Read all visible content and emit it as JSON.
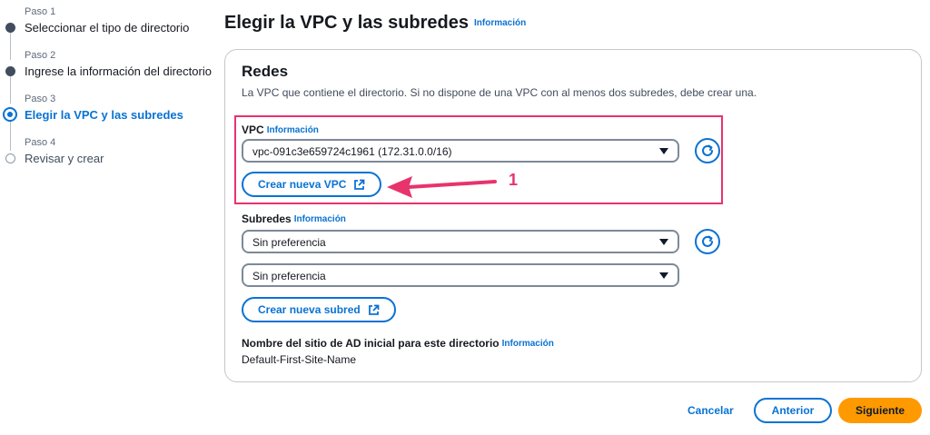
{
  "steps": [
    {
      "small": "Paso 1",
      "label": "Seleccionar el tipo de directorio",
      "state": "done"
    },
    {
      "small": "Paso 2",
      "label": "Ingrese la información del directorio",
      "state": "done"
    },
    {
      "small": "Paso 3",
      "label": "Elegir la VPC y las subredes",
      "state": "active"
    },
    {
      "small": "Paso 4",
      "label": "Revisar y crear",
      "state": "pending"
    }
  ],
  "page": {
    "title": "Elegir la VPC y las subredes",
    "info": "Información"
  },
  "networks": {
    "title": "Redes",
    "description": "La VPC que contiene el directorio. Si no dispone de una VPC con al menos dos subredes, debe crear una.",
    "vpc": {
      "label": "VPC",
      "info": "Información",
      "selected": "vpc-091c3e659724c1961 (172.31.0.0/16)",
      "create_button": "Crear nueva VPC"
    },
    "subnets": {
      "label": "Subredes",
      "info": "Información",
      "subnet1": "Sin preferencia",
      "subnet2": "Sin preferencia",
      "create_button": "Crear nueva subred"
    },
    "site": {
      "label": "Nombre del sitio de AD inicial para este directorio",
      "info": "Información",
      "value": "Default-First-Site-Name"
    }
  },
  "annotation": {
    "number": "1",
    "color": "#e8336d"
  },
  "footer": {
    "cancel": "Cancelar",
    "previous": "Anterior",
    "next": "Siguiente"
  },
  "colors": {
    "accent": "#0972d3",
    "primary_button": "#ff9900",
    "text": "#16191f"
  }
}
